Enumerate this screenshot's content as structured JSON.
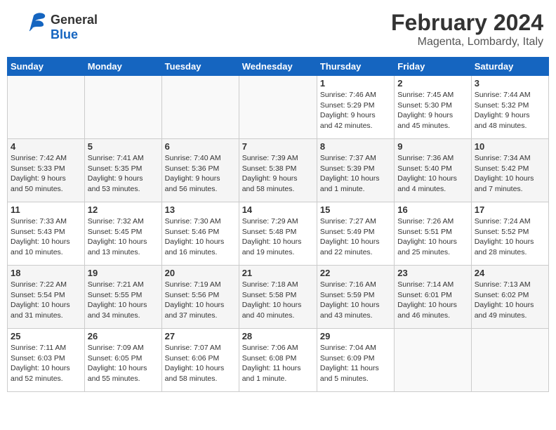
{
  "header": {
    "logo_general": "General",
    "logo_blue": "Blue",
    "month_year": "February 2024",
    "location": "Magenta, Lombardy, Italy"
  },
  "days_of_week": [
    "Sunday",
    "Monday",
    "Tuesday",
    "Wednesday",
    "Thursday",
    "Friday",
    "Saturday"
  ],
  "weeks": [
    [
      {
        "day": "",
        "info": ""
      },
      {
        "day": "",
        "info": ""
      },
      {
        "day": "",
        "info": ""
      },
      {
        "day": "",
        "info": ""
      },
      {
        "day": "1",
        "info": "Sunrise: 7:46 AM\nSunset: 5:29 PM\nDaylight: 9 hours\nand 42 minutes."
      },
      {
        "day": "2",
        "info": "Sunrise: 7:45 AM\nSunset: 5:30 PM\nDaylight: 9 hours\nand 45 minutes."
      },
      {
        "day": "3",
        "info": "Sunrise: 7:44 AM\nSunset: 5:32 PM\nDaylight: 9 hours\nand 48 minutes."
      }
    ],
    [
      {
        "day": "4",
        "info": "Sunrise: 7:42 AM\nSunset: 5:33 PM\nDaylight: 9 hours\nand 50 minutes."
      },
      {
        "day": "5",
        "info": "Sunrise: 7:41 AM\nSunset: 5:35 PM\nDaylight: 9 hours\nand 53 minutes."
      },
      {
        "day": "6",
        "info": "Sunrise: 7:40 AM\nSunset: 5:36 PM\nDaylight: 9 hours\nand 56 minutes."
      },
      {
        "day": "7",
        "info": "Sunrise: 7:39 AM\nSunset: 5:38 PM\nDaylight: 9 hours\nand 58 minutes."
      },
      {
        "day": "8",
        "info": "Sunrise: 7:37 AM\nSunset: 5:39 PM\nDaylight: 10 hours\nand 1 minute."
      },
      {
        "day": "9",
        "info": "Sunrise: 7:36 AM\nSunset: 5:40 PM\nDaylight: 10 hours\nand 4 minutes."
      },
      {
        "day": "10",
        "info": "Sunrise: 7:34 AM\nSunset: 5:42 PM\nDaylight: 10 hours\nand 7 minutes."
      }
    ],
    [
      {
        "day": "11",
        "info": "Sunrise: 7:33 AM\nSunset: 5:43 PM\nDaylight: 10 hours\nand 10 minutes."
      },
      {
        "day": "12",
        "info": "Sunrise: 7:32 AM\nSunset: 5:45 PM\nDaylight: 10 hours\nand 13 minutes."
      },
      {
        "day": "13",
        "info": "Sunrise: 7:30 AM\nSunset: 5:46 PM\nDaylight: 10 hours\nand 16 minutes."
      },
      {
        "day": "14",
        "info": "Sunrise: 7:29 AM\nSunset: 5:48 PM\nDaylight: 10 hours\nand 19 minutes."
      },
      {
        "day": "15",
        "info": "Sunrise: 7:27 AM\nSunset: 5:49 PM\nDaylight: 10 hours\nand 22 minutes."
      },
      {
        "day": "16",
        "info": "Sunrise: 7:26 AM\nSunset: 5:51 PM\nDaylight: 10 hours\nand 25 minutes."
      },
      {
        "day": "17",
        "info": "Sunrise: 7:24 AM\nSunset: 5:52 PM\nDaylight: 10 hours\nand 28 minutes."
      }
    ],
    [
      {
        "day": "18",
        "info": "Sunrise: 7:22 AM\nSunset: 5:54 PM\nDaylight: 10 hours\nand 31 minutes."
      },
      {
        "day": "19",
        "info": "Sunrise: 7:21 AM\nSunset: 5:55 PM\nDaylight: 10 hours\nand 34 minutes."
      },
      {
        "day": "20",
        "info": "Sunrise: 7:19 AM\nSunset: 5:56 PM\nDaylight: 10 hours\nand 37 minutes."
      },
      {
        "day": "21",
        "info": "Sunrise: 7:18 AM\nSunset: 5:58 PM\nDaylight: 10 hours\nand 40 minutes."
      },
      {
        "day": "22",
        "info": "Sunrise: 7:16 AM\nSunset: 5:59 PM\nDaylight: 10 hours\nand 43 minutes."
      },
      {
        "day": "23",
        "info": "Sunrise: 7:14 AM\nSunset: 6:01 PM\nDaylight: 10 hours\nand 46 minutes."
      },
      {
        "day": "24",
        "info": "Sunrise: 7:13 AM\nSunset: 6:02 PM\nDaylight: 10 hours\nand 49 minutes."
      }
    ],
    [
      {
        "day": "25",
        "info": "Sunrise: 7:11 AM\nSunset: 6:03 PM\nDaylight: 10 hours\nand 52 minutes."
      },
      {
        "day": "26",
        "info": "Sunrise: 7:09 AM\nSunset: 6:05 PM\nDaylight: 10 hours\nand 55 minutes."
      },
      {
        "day": "27",
        "info": "Sunrise: 7:07 AM\nSunset: 6:06 PM\nDaylight: 10 hours\nand 58 minutes."
      },
      {
        "day": "28",
        "info": "Sunrise: 7:06 AM\nSunset: 6:08 PM\nDaylight: 11 hours\nand 1 minute."
      },
      {
        "day": "29",
        "info": "Sunrise: 7:04 AM\nSunset: 6:09 PM\nDaylight: 11 hours\nand 5 minutes."
      },
      {
        "day": "",
        "info": ""
      },
      {
        "day": "",
        "info": ""
      }
    ]
  ]
}
